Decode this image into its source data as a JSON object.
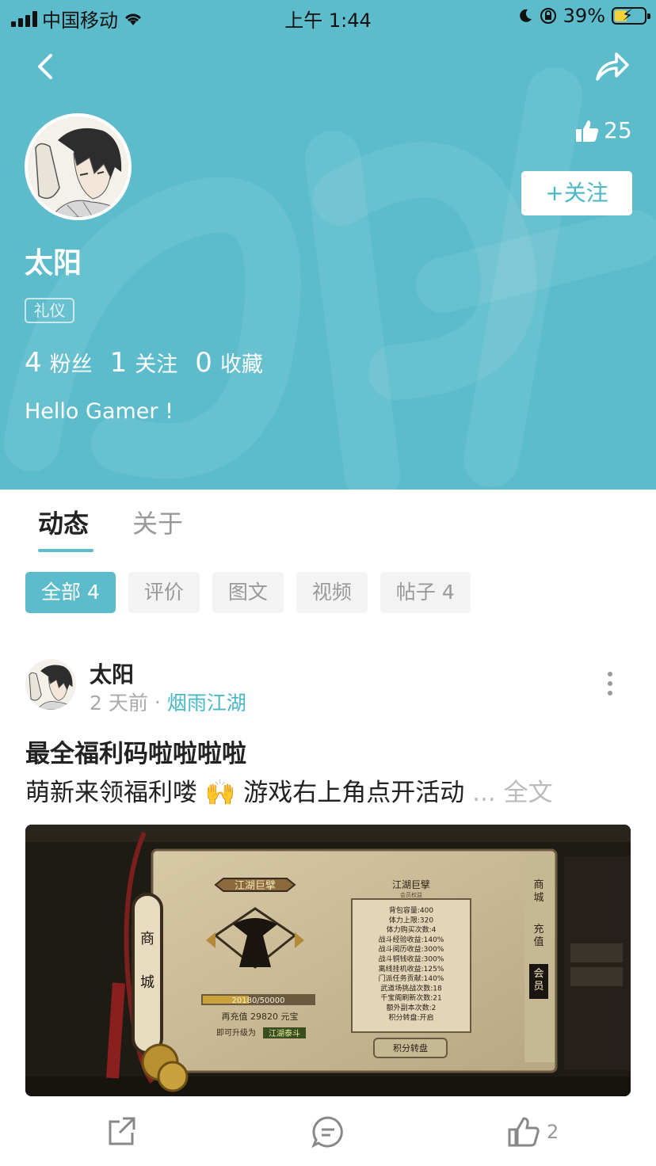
{
  "status_bar": {
    "carrier": "中国移动",
    "time": "上午 1:44",
    "battery": "39%"
  },
  "profile": {
    "name": "太阳",
    "tag": "礼仪",
    "likes": "25",
    "follow_label": "+关注",
    "stats": [
      {
        "num": "4",
        "label": "粉丝"
      },
      {
        "num": "1",
        "label": "关注"
      },
      {
        "num": "0",
        "label": "收藏"
      }
    ],
    "bio": "Hello Gamer !"
  },
  "tabs": {
    "active": "动态",
    "inactive": "关于"
  },
  "filters": [
    {
      "label": "全部 4"
    },
    {
      "label": "评价"
    },
    {
      "label": "图文"
    },
    {
      "label": "视频"
    },
    {
      "label": "帖子 4"
    }
  ],
  "post": {
    "author": "太阳",
    "time": "2 天前",
    "separator": "·",
    "game": "烟雨江湖",
    "title": "最全福利码啦啦啦啦",
    "body": "萌新来领福利喽 🙌 游戏右上角点开活动",
    "ellipsis": " ...",
    "full_text_label": " 全文",
    "image": {
      "banner": "江湖巨擘",
      "panel_title": "江湖巨擘",
      "panel_subtitle": "会员权益",
      "benefits": [
        "背包容量:400",
        "体力上限:320",
        "体力购买次数:4",
        "战斗经验收益:140%",
        "战斗阅历收益:300%",
        "战斗铜钱收益:300%",
        "离线挂机收益:125%",
        "门派任务贡献:140%",
        "武道场挑战次数:18",
        "千宝阁刷新次数:21",
        "额外副本次数:2",
        "积分转盘:开启"
      ],
      "wheel_button": "积分转盘",
      "progress_text": "20180/50000",
      "recharge_line": "再充值   29820 元宝",
      "upgrade_line": "即可升级为",
      "upgrade_target": "江湖泰斗",
      "side_tabs": [
        "商城",
        "充值",
        "会员"
      ],
      "scroll_label": "商城"
    },
    "like_count": "2"
  },
  "colors": {
    "accent": "#5cbccb",
    "link": "#4bb8c6"
  }
}
